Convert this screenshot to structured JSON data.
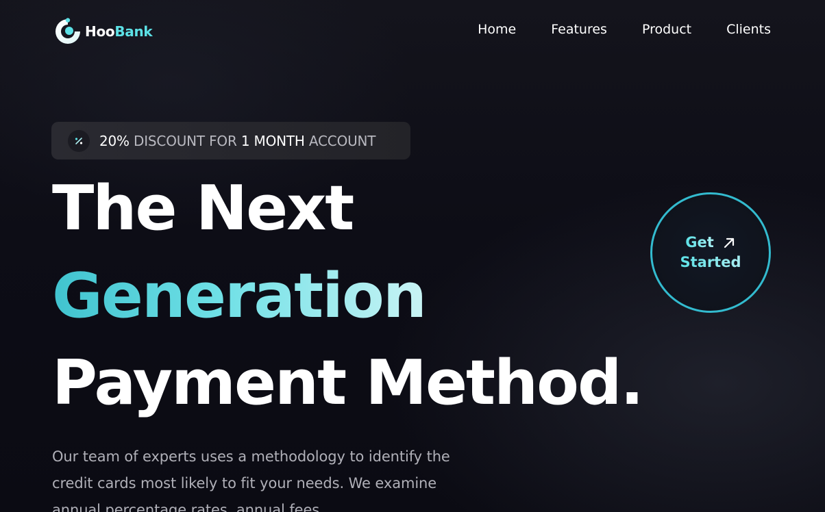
{
  "nav": {
    "logo": {
      "icon": "hoobank-logo-icon",
      "name_part1": "Hoo",
      "name_part2": "Bank"
    },
    "links": [
      "Home",
      "Features",
      "Product",
      "Clients"
    ]
  },
  "badge": {
    "icon": "discount-icon",
    "percent": "20%",
    "mid": "DISCOUNT FOR",
    "period": "1 MONTH",
    "end": "ACCOUNT"
  },
  "hero": {
    "line1": "The Next",
    "line2": "Generation",
    "line3": "Payment Method.",
    "paragraph": "Our team of experts uses a methodology to identify the credit cards most likely to fit your needs. We examine annual percentage rates, annual fees"
  },
  "cta": {
    "line1": "Get",
    "line2": "Started",
    "icon": "arrow-up-right-icon"
  },
  "colors": {
    "accent": "#5ce1e6",
    "cta_border": "#33bbcf",
    "background": "#0b0b12"
  }
}
